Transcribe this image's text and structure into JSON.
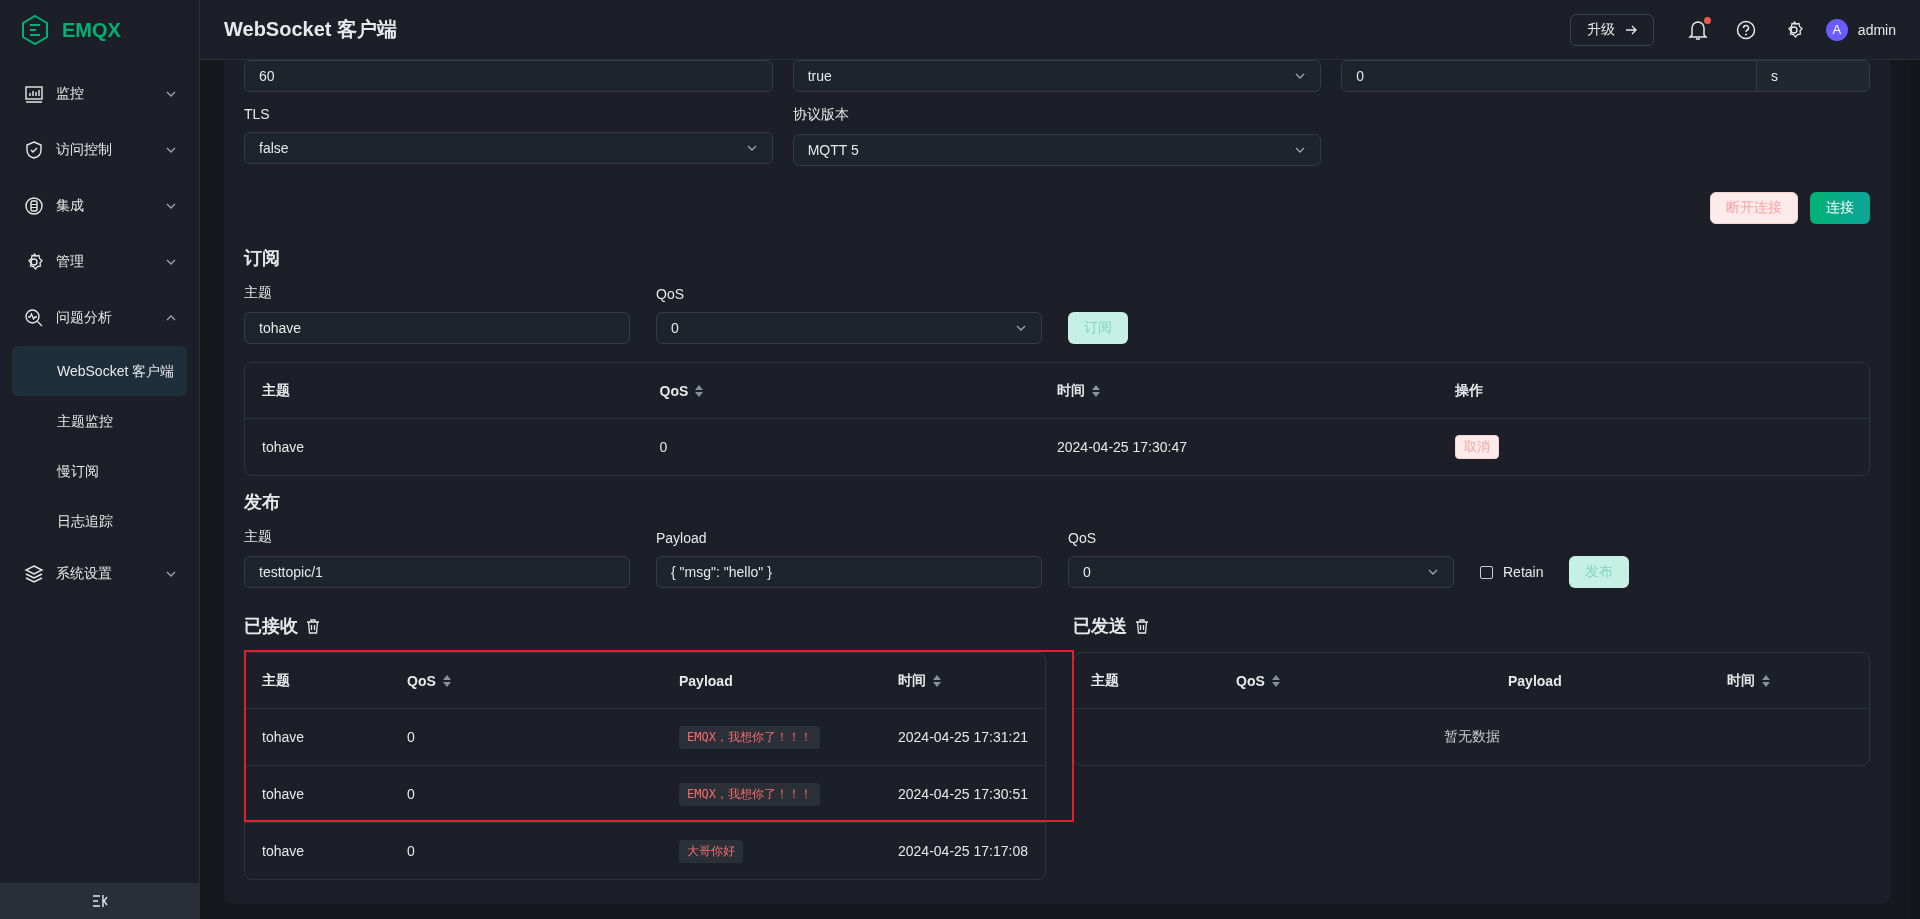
{
  "sidebar": {
    "logo": "EMQX",
    "items": [
      {
        "label": "监控",
        "expanded": false
      },
      {
        "label": "访问控制",
        "expanded": false
      },
      {
        "label": "集成",
        "expanded": false
      },
      {
        "label": "管理",
        "expanded": false
      },
      {
        "label": "问题分析",
        "expanded": true,
        "children": [
          {
            "label": "WebSocket 客户端",
            "selected": true
          },
          {
            "label": "主题监控",
            "selected": false
          },
          {
            "label": "慢订阅",
            "selected": false
          },
          {
            "label": "日志追踪",
            "selected": false
          }
        ]
      },
      {
        "label": "系统设置",
        "expanded": false
      }
    ]
  },
  "header": {
    "title": "WebSocket 客户端",
    "upgrade": "升级",
    "unread": true,
    "avatar": "A",
    "user": "admin"
  },
  "connection": {
    "rows": [
      [
        {
          "kind": "input",
          "value": "60"
        },
        {
          "kind": "select",
          "value": "true"
        },
        {
          "kind": "unit",
          "value": "0",
          "unit": "s"
        }
      ],
      [
        {
          "kind": "select",
          "label": "TLS",
          "value": "false"
        },
        {
          "kind": "select",
          "label": "协议版本",
          "value": "MQTT 5"
        }
      ]
    ],
    "buttons": [
      {
        "kind": "danger",
        "label": "断开连接",
        "disabled": true
      },
      {
        "kind": "primary",
        "label": "连接",
        "disabled": false
      }
    ]
  },
  "subscribe": {
    "title": "订阅",
    "fields": [
      {
        "kind": "input",
        "label": "主题",
        "value": "tohave"
      },
      {
        "kind": "select",
        "label": "QoS",
        "value": "0"
      }
    ],
    "button": {
      "label": "订阅",
      "disabled": true
    },
    "columns": [
      {
        "label": "主题",
        "sortable": false
      },
      {
        "label": "QoS",
        "sortable": true
      },
      {
        "label": "时间",
        "sortable": true
      },
      {
        "label": "操作",
        "sortable": false
      }
    ],
    "rows": [
      {
        "topic": "tohave",
        "qos": "0",
        "time": "2024-04-25 17:30:47",
        "action": "取消"
      }
    ]
  },
  "publish": {
    "title": "发布",
    "fields": [
      {
        "kind": "input",
        "label": "主题",
        "value": "testtopic/1"
      },
      {
        "kind": "input",
        "label": "Payload",
        "value": "{ \"msg\": \"hello\" }"
      },
      {
        "kind": "select",
        "label": "QoS",
        "value": "0"
      }
    ],
    "retain": {
      "label": "Retain",
      "checked": false
    },
    "button": {
      "label": "发布",
      "disabled": true
    }
  },
  "received": {
    "title": "已接收",
    "header_highlighted": true,
    "columns": [
      {
        "label": "主题",
        "sortable": false
      },
      {
        "label": "QoS",
        "sortable": true
      },
      {
        "label": "Payload",
        "sortable": false
      },
      {
        "label": "时间",
        "sortable": true
      }
    ],
    "rows": [
      {
        "topic": "tohave",
        "qos": "0",
        "payload": "EMQX，我想你了！！！",
        "time": "2024-04-25 17:31:21",
        "highlighted": true
      },
      {
        "topic": "tohave",
        "qos": "0",
        "payload": "EMQX，我想你了！！！",
        "time": "2024-04-25 17:30:51",
        "highlighted": true
      },
      {
        "topic": "tohave",
        "qos": "0",
        "payload": "大哥你好",
        "time": "2024-04-25 17:17:08",
        "highlighted": false
      }
    ]
  },
  "sent": {
    "title": "已发送",
    "columns": [
      {
        "label": "主题",
        "sortable": false
      },
      {
        "label": "QoS",
        "sortable": true
      },
      {
        "label": "Payload",
        "sortable": false
      },
      {
        "label": "时间",
        "sortable": true
      }
    ],
    "empty_text": "暂无数据"
  }
}
